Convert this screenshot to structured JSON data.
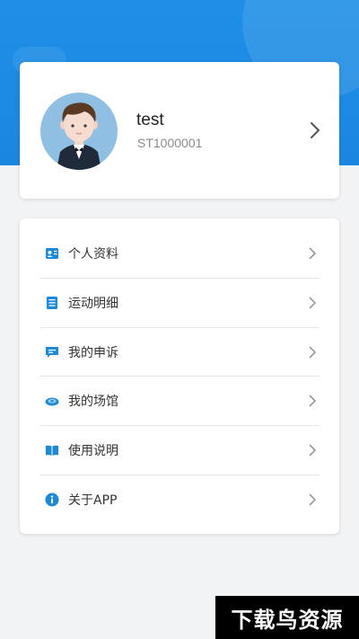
{
  "theme": {
    "header_color": "#1f8fe6",
    "icon_color": "#1a8ad9",
    "page_bg": "#f2f3f5"
  },
  "profile": {
    "name": "test",
    "id": "ST1000001",
    "avatar_icon": "user-avatar-icon",
    "chevron_icon": "chevron-right-icon"
  },
  "menu": {
    "items": [
      {
        "label": "个人资料",
        "icon": "profile-card-icon"
      },
      {
        "label": "运动明细",
        "icon": "document-list-icon"
      },
      {
        "label": "我的申诉",
        "icon": "message-bubble-icon"
      },
      {
        "label": "我的场馆",
        "icon": "stadium-icon"
      },
      {
        "label": "使用说明",
        "icon": "book-icon"
      },
      {
        "label": "关于APP",
        "icon": "info-icon"
      }
    ]
  },
  "watermark": {
    "text": "下载鸟资源"
  }
}
